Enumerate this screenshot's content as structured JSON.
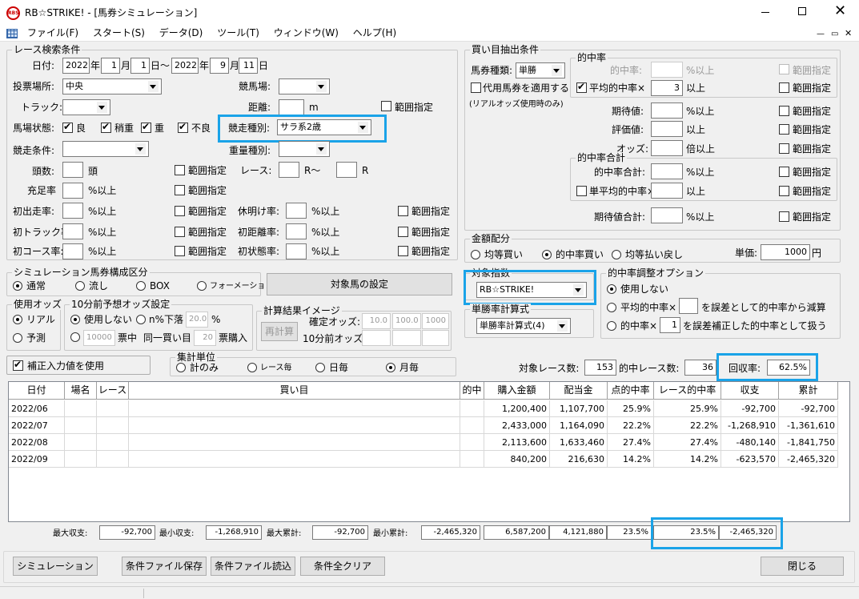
{
  "window": {
    "title": "RB☆STRIKE! - [馬券シミュレーション]",
    "logo": "RBS"
  },
  "menu": [
    "ファイル(F)",
    "スタート(S)",
    "データ(D)",
    "ツール(T)",
    "ウィンドウ(W)",
    "ヘルプ(H)"
  ],
  "race": {
    "group": "レース検索条件",
    "date_label": "日付:",
    "date_from": {
      "year": "2022",
      "y": "年",
      "month": "1",
      "m": "月",
      "day": "1",
      "d": "日～"
    },
    "date_to": {
      "year": "2022",
      "y": "年",
      "month": "9",
      "m": "月",
      "day": "11",
      "d": "日"
    },
    "venue_label": "投票場所:",
    "venue": "中央",
    "track_name_label": "競馬場:",
    "track_label": "トラック:",
    "distance_label": "距離:",
    "distance_unit": "m",
    "range": "範囲指定",
    "ground_label": "馬場状態:",
    "ground": [
      "良",
      "稍重",
      "重",
      "不良"
    ],
    "race_type_label": "競走種別:",
    "race_type": "サラ系2歳",
    "cond_label": "競走条件:",
    "weight_label": "重量種別:",
    "heads_label": "頭数:",
    "heads_unit": "頭",
    "race_label": "レース:",
    "race_from": "R～",
    "race_to": "R",
    "fill_label": "充足率",
    "pct_over": "%以上",
    "rows": [
      [
        "初出走率:",
        "休明け率:"
      ],
      [
        "初トラック率:",
        "初距離率:"
      ],
      [
        "初コース率:",
        "初状態率:"
      ]
    ]
  },
  "picks": {
    "group": "買い目抽出条件",
    "ticket_label": "馬券種類:",
    "ticket": "単勝",
    "proxy": "代用馬券を適用する",
    "proxy_note": "(リアルオッズ使用時のみ)",
    "hit_group": "的中率",
    "hit_rate": "的中率:",
    "avg_hit": "平均的中率×",
    "avg_hit_val": "3",
    "over": "以上",
    "pct_over": "%以上",
    "expect": "期待値:",
    "eval": "評価値:",
    "odds": "オッズ:",
    "odds_unit": "倍以上",
    "total_group": "的中率合計",
    "hit_total": "的中率合計:",
    "single_avg": "単平均的中率×",
    "expect_total": "期待値合計:",
    "range": "範囲指定"
  },
  "money": {
    "group": "金額配分",
    "options": [
      "均等買い",
      "的中率買い",
      "均等払い戻し"
    ],
    "unit_label": "単価:",
    "unit": "1000",
    "yen": "円"
  },
  "sim": {
    "group": "シミュレーション馬券構成区分",
    "options": [
      "通常",
      "流し",
      "BOX",
      "フォーメーション"
    ],
    "button": "対象馬の設定"
  },
  "index": {
    "group": "対象指数",
    "value": "RB☆STRIKE!"
  },
  "singles": {
    "group": "単勝率計算式",
    "value": "単勝率計算式(4)"
  },
  "adjust": {
    "group": "的中率調整オプション",
    "opt1": "使用しない",
    "opt2a": "平均的中率×",
    "opt2b": "を誤差として的中率から減算",
    "opt3a": "的中率×",
    "opt3b": "を誤差補正した的中率として扱う",
    "val": "1"
  },
  "odds_use": {
    "group": "使用オッズ",
    "options": [
      "リアル",
      "予測"
    ]
  },
  "pre10": {
    "group": "10分前予想オッズ設定",
    "nouse": "使用しない",
    "pct_drop": "n%下落",
    "pct": "20.0",
    "pct_unit": "%",
    "count": "10000",
    "ticket_in": "票中",
    "same": "同一買い目",
    "buy": "20",
    "buy_unit": "票購入"
  },
  "calc_img": {
    "group": "計算結果イメージ",
    "button": "再計算",
    "confirmed": "確定オッズ:",
    "pre": "10分前オッズ:",
    "c": [
      "10.0",
      "100.0",
      "1000"
    ]
  },
  "correct": "補正入力値を使用",
  "agg": {
    "group": "集計単位",
    "options": [
      "計のみ",
      "レース毎",
      "日毎",
      "月毎"
    ]
  },
  "stats": {
    "target_label": "対象レース数:",
    "target": "153",
    "hit_label": "的中レース数:",
    "hit": "36",
    "ret_label": "回収率:",
    "ret": "62.5%"
  },
  "table": {
    "headers": [
      "日付",
      "場名",
      "レース",
      "買い目",
      "的中",
      "購入金額",
      "配当金",
      "点的中率",
      "レース的中率",
      "収支",
      "累計"
    ],
    "rows": [
      [
        "2022/06",
        "",
        "",
        "",
        "",
        "1,200,400",
        "1,107,700",
        "25.9%",
        "25.9%",
        "-92,700",
        "-92,700"
      ],
      [
        "2022/07",
        "",
        "",
        "",
        "",
        "2,433,000",
        "1,164,090",
        "22.2%",
        "22.2%",
        "-1,268,910",
        "-1,361,610"
      ],
      [
        "2022/08",
        "",
        "",
        "",
        "",
        "2,113,600",
        "1,633,460",
        "27.4%",
        "27.4%",
        "-480,140",
        "-1,841,750"
      ],
      [
        "2022/09",
        "",
        "",
        "",
        "",
        "840,200",
        "216,630",
        "14.2%",
        "14.2%",
        "-623,570",
        "-2,465,320"
      ]
    ]
  },
  "summary": {
    "max_income_label": "最大収支:",
    "max_income": "-92,700",
    "min_income_label": "最小収支:",
    "min_income": "-1,268,910",
    "max_cum_label": "最大累計:",
    "max_cum": "-92,700",
    "min_cum_label": "最小累計:",
    "min_cum": "-2,465,320",
    "purchase": "6,587,200",
    "payout": "4,121,880",
    "point_rate": "23.5%",
    "race_rate": "23.5%",
    "balance": "-2,465,320"
  },
  "buttons": {
    "simulate": "シミュレーション",
    "save": "条件ファイル保存",
    "load": "条件ファイル読込",
    "clear": "条件全クリア",
    "close": "閉じる"
  },
  "colors": {
    "highlight": "#1aa3e8"
  }
}
